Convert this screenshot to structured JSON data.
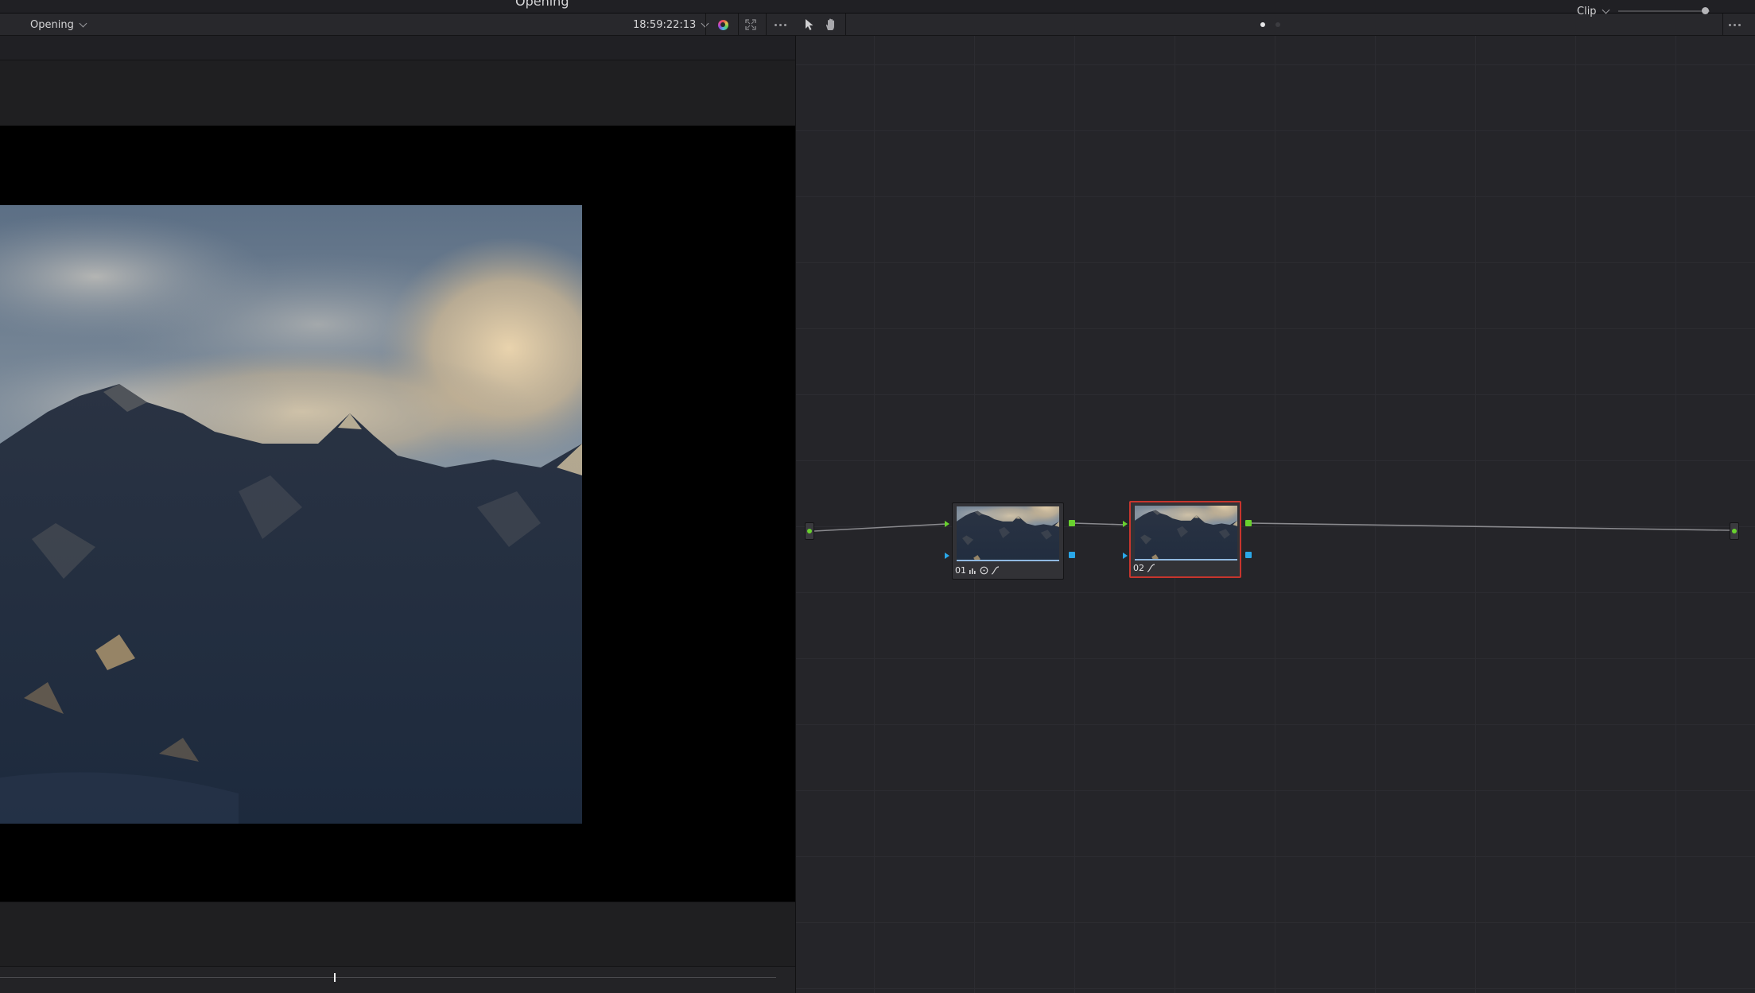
{
  "window": {
    "title": "Opening"
  },
  "viewer_toolbar": {
    "clip_name": "Opening",
    "timecode": "18:59:22:13",
    "icons": [
      "color-wheel-icon",
      "fullscreen-icon",
      "more-options-icon"
    ]
  },
  "node_toolbar": {
    "tools": [
      "pointer-icon",
      "hand-icon"
    ],
    "mode": "Clip",
    "zoom_level": 0.95,
    "page_indicator_active": 0,
    "page_count": 2
  },
  "nodes": [
    {
      "number": "01",
      "tools": [
        "levels-icon",
        "circle-window-icon",
        "curve-icon"
      ],
      "selected": false
    },
    {
      "number": "02",
      "tools": [
        "curve-icon"
      ],
      "selected": true
    }
  ],
  "timeline": {
    "playhead_position": 0.43
  },
  "colors": {
    "accent_green": "#69d12e",
    "accent_blue": "#2aa7e8",
    "selection_red": "#c8352d"
  }
}
